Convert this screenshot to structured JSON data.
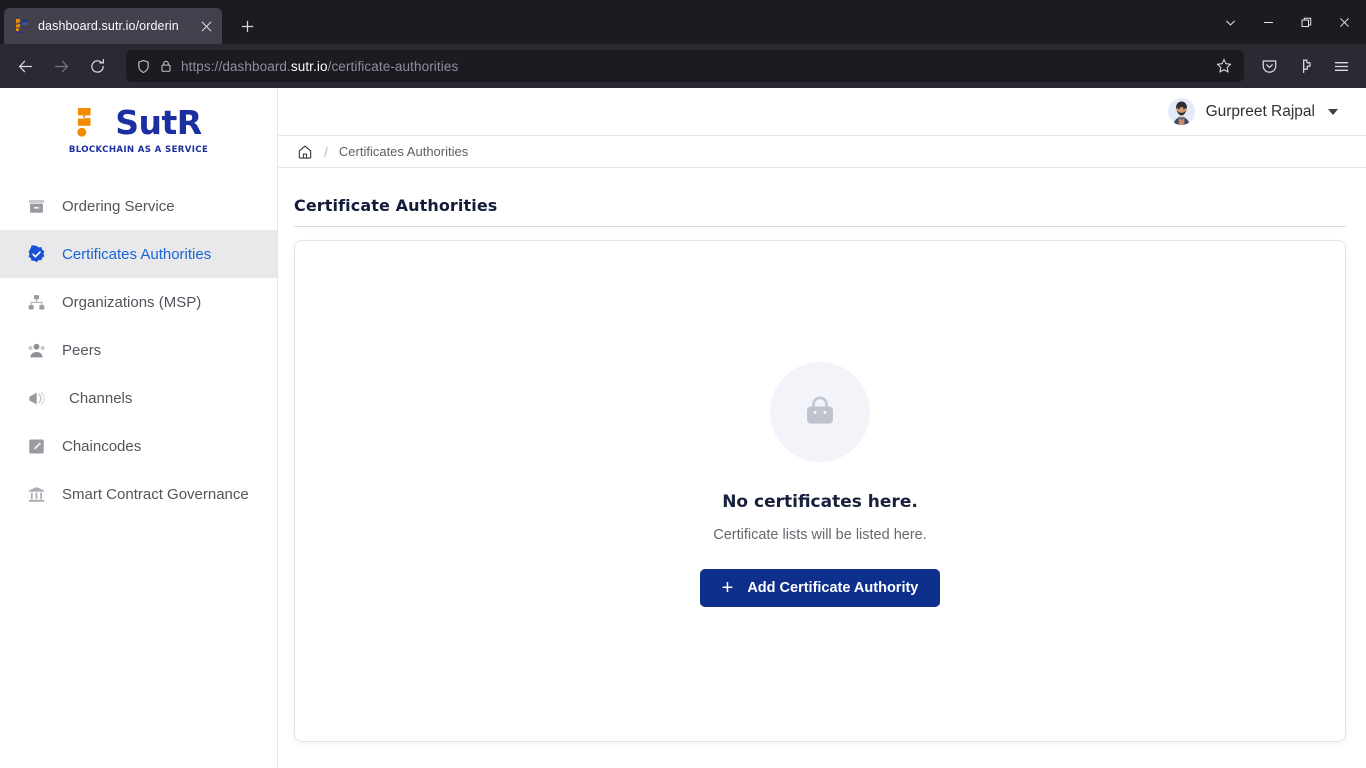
{
  "browser": {
    "tab": {
      "title": "dashboard.sutr.io/orderin",
      "favicon_icon": "sutr-favicon",
      "close_icon": "close-icon"
    },
    "new_tab_icon": "plus-icon",
    "window_controls": [
      {
        "name": "tab-list-chevron",
        "icon": "chevron-down-icon"
      },
      {
        "name": "minimize",
        "icon": "minimize-icon"
      },
      {
        "name": "restore",
        "icon": "restore-icon"
      },
      {
        "name": "close",
        "icon": "close-icon"
      }
    ],
    "nav": {
      "back_icon": "arrow-left-icon",
      "forward_icon": "arrow-right-icon",
      "reload_icon": "reload-icon"
    },
    "url": {
      "shield_icon": "shield-icon",
      "lock_icon": "lock-icon",
      "prefix": "https://dashboard.",
      "domain": "sutr.io",
      "path": "/certificate-authorities",
      "full": "https://dashboard.sutr.io/certificate-authorities",
      "bookmark_icon": "star-icon"
    },
    "toolbar_icons": [
      {
        "name": "pocket-icon"
      },
      {
        "name": "extensions-icon"
      },
      {
        "name": "app-menu-icon"
      }
    ]
  },
  "sidebar": {
    "logo": {
      "word": "SutR",
      "tagline": "BLOCKCHAIN AS A SERVICE",
      "mark_icon": "sutr-logo-mark",
      "mark_color": "#f28a00",
      "word_color": "#1b2f9e"
    },
    "items": [
      {
        "label": "Ordering Service",
        "icon": "archive-box-icon",
        "active": false
      },
      {
        "label": "Certificates Authorities",
        "icon": "verified-badge-icon",
        "active": true
      },
      {
        "label": "Organizations (MSP)",
        "icon": "sitemap-icon",
        "active": false
      },
      {
        "label": "Peers",
        "icon": "people-icon",
        "active": false
      },
      {
        "label": "Channels",
        "icon": "megaphone-icon",
        "active": false
      },
      {
        "label": "Chaincodes",
        "icon": "code-edit-icon",
        "active": false
      },
      {
        "label": "Smart Contract Governance",
        "icon": "bank-icon",
        "active": false
      }
    ],
    "active_color": "#1766d4",
    "active_bg": "#e9e9ec"
  },
  "header": {
    "user_name": "Gurpreet Rajpal",
    "avatar_icon": "user-avatar",
    "dropdown_icon": "caret-down-icon"
  },
  "breadcrumb": {
    "home_icon": "home-icon",
    "separator": "/",
    "current": "Certificates Authorities"
  },
  "main": {
    "page_title": "Certificate Authorities",
    "empty_state": {
      "illustration_icon": "bag-icon",
      "title": "No certificates here.",
      "subtitle": "Certificate lists will be listed here.",
      "button_label": "Add Certificate Authority",
      "button_icon": "plus-icon",
      "button_color": "#0e2f8c"
    }
  }
}
